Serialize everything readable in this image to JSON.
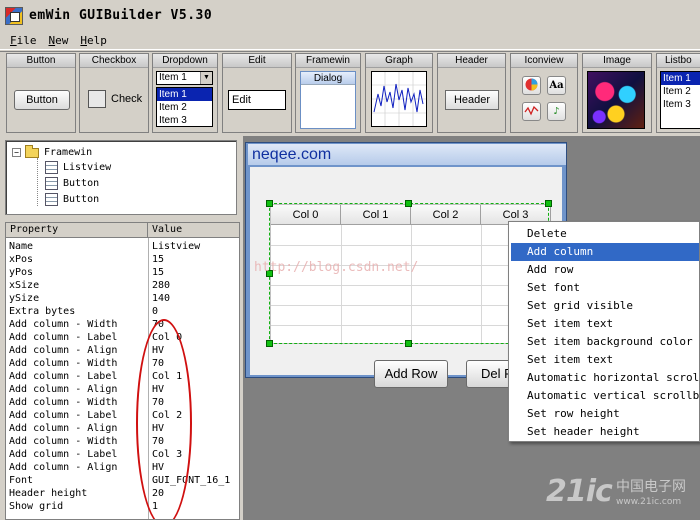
{
  "window": {
    "title": "emWin GUIBuilder V5.30",
    "icon": "app-icon"
  },
  "menubar": [
    {
      "label": "File",
      "accel": "F",
      "rest": "ile"
    },
    {
      "label": "New",
      "accel": "N",
      "rest": "ew"
    },
    {
      "label": "Help",
      "accel": "H",
      "rest": "elp"
    }
  ],
  "palette": {
    "button": {
      "header": "Button",
      "sample": "Button"
    },
    "checkbox": {
      "header": "Checkbox",
      "sample": "Check"
    },
    "dropdown": {
      "header": "Dropdown",
      "selected": "Item 1",
      "options": [
        "Item 1",
        "Item 2",
        "Item 3"
      ]
    },
    "edit": {
      "header": "Edit",
      "sample": "Edit"
    },
    "framewin": {
      "header": "Framewin",
      "sample": "Dialog"
    },
    "graph": {
      "header": "Graph"
    },
    "header": {
      "header": "Header",
      "sample": "Header"
    },
    "iconview": {
      "header": "Iconview",
      "icons": [
        "colorwheel-icon",
        "font-aa-icon",
        "wave-icon",
        "music-note-icon"
      ]
    },
    "image": {
      "header": "Image"
    },
    "listbox": {
      "header": "Listbo",
      "options": [
        "Item 1",
        "Item 2",
        "Item 3"
      ]
    }
  },
  "tree": {
    "root": "Framewin",
    "children": [
      "Listview",
      "Button",
      "Button"
    ]
  },
  "properties": {
    "col_property": "Property",
    "col_value": "Value",
    "rows": [
      [
        "Name",
        "Listview"
      ],
      [
        "xPos",
        "15"
      ],
      [
        "yPos",
        "15"
      ],
      [
        "xSize",
        "280"
      ],
      [
        "ySize",
        "140"
      ],
      [
        "Extra bytes",
        "0"
      ],
      [
        "Add column - Width",
        "70"
      ],
      [
        "Add column - Label",
        "Col 0"
      ],
      [
        "Add column - Align",
        "HV"
      ],
      [
        "Add column - Width",
        "70"
      ],
      [
        "Add column - Label",
        "Col 1"
      ],
      [
        "Add column - Align",
        "HV"
      ],
      [
        "Add column - Width",
        "70"
      ],
      [
        "Add column - Label",
        "Col 2"
      ],
      [
        "Add column - Align",
        "HV"
      ],
      [
        "Add column - Width",
        "70"
      ],
      [
        "Add column - Label",
        "Col 3"
      ],
      [
        "Add column - Align",
        "HV"
      ],
      [
        "Font",
        "GUI_FONT_16_1"
      ],
      [
        "Header height",
        "20"
      ],
      [
        "Show grid",
        "1"
      ]
    ]
  },
  "framewin": {
    "title": "neqee.com",
    "listview_columns": [
      "Col 0",
      "Col 1",
      "Col 2",
      "Col 3"
    ],
    "buttons": [
      "Add Row",
      "Del R"
    ]
  },
  "watermark": "http://blog.csdn.net/",
  "context_menu": {
    "items": [
      "Delete",
      "Add column",
      "Add row",
      "Set font",
      "Set grid visible",
      "Set item text",
      "Set item background color",
      "Set item text",
      "Automatic horizontal scrollbar",
      "Automatic vertical scrollbar",
      "Set row height",
      "Set header height"
    ],
    "highlighted": "Add column"
  },
  "brand": {
    "logo": "21ic",
    "cn": "中国电子网",
    "url": "www.21ic.com"
  }
}
